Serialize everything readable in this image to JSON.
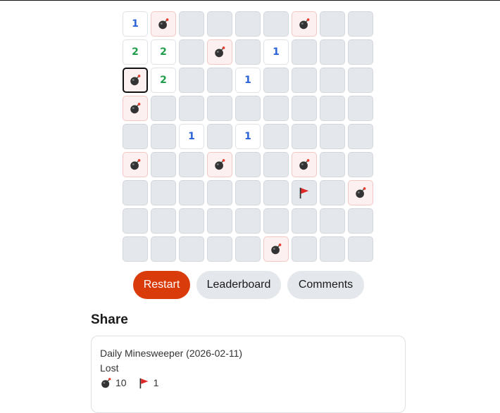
{
  "board": {
    "rows": [
      [
        "1",
        "mine",
        "",
        "",
        "",
        "",
        "mine",
        "",
        ""
      ],
      [
        "2",
        "2",
        "",
        "mine",
        "",
        "1",
        "",
        "",
        ""
      ],
      [
        "mine-selected",
        "2",
        "",
        "",
        "1",
        "",
        "",
        "",
        ""
      ],
      [
        "mine",
        "",
        "",
        "",
        "",
        "",
        "",
        "",
        ""
      ],
      [
        "",
        "",
        "1",
        "",
        "1",
        "",
        "",
        "",
        ""
      ],
      [
        "mine",
        "",
        "",
        "mine",
        "",
        "",
        "mine",
        "",
        ""
      ],
      [
        "",
        "",
        "",
        "",
        "",
        "",
        "flag",
        "",
        "mine"
      ],
      [
        "",
        "",
        "",
        "",
        "",
        "",
        "",
        "",
        ""
      ],
      [
        "",
        "",
        "",
        "",
        "",
        "mine",
        "",
        "",
        ""
      ]
    ]
  },
  "actions": {
    "restart_label": "Restart",
    "leaderboard_label": "Leaderboard",
    "comments_label": "Comments"
  },
  "share": {
    "heading": "Share",
    "title_line": "Daily Minesweeper (2026-02-11)",
    "result": "Lost",
    "mine_count": "10",
    "flag_count": "1"
  },
  "colors": {
    "accent": "#d93b0b",
    "number_1": "#2b63d9",
    "number_2": "#1f9d4a",
    "mine_cell_bg": "#fdf0f0",
    "hidden_cell_bg": "#e4e7eb"
  },
  "icons": {
    "mine": "bomb-icon",
    "flag": "flag-icon"
  }
}
